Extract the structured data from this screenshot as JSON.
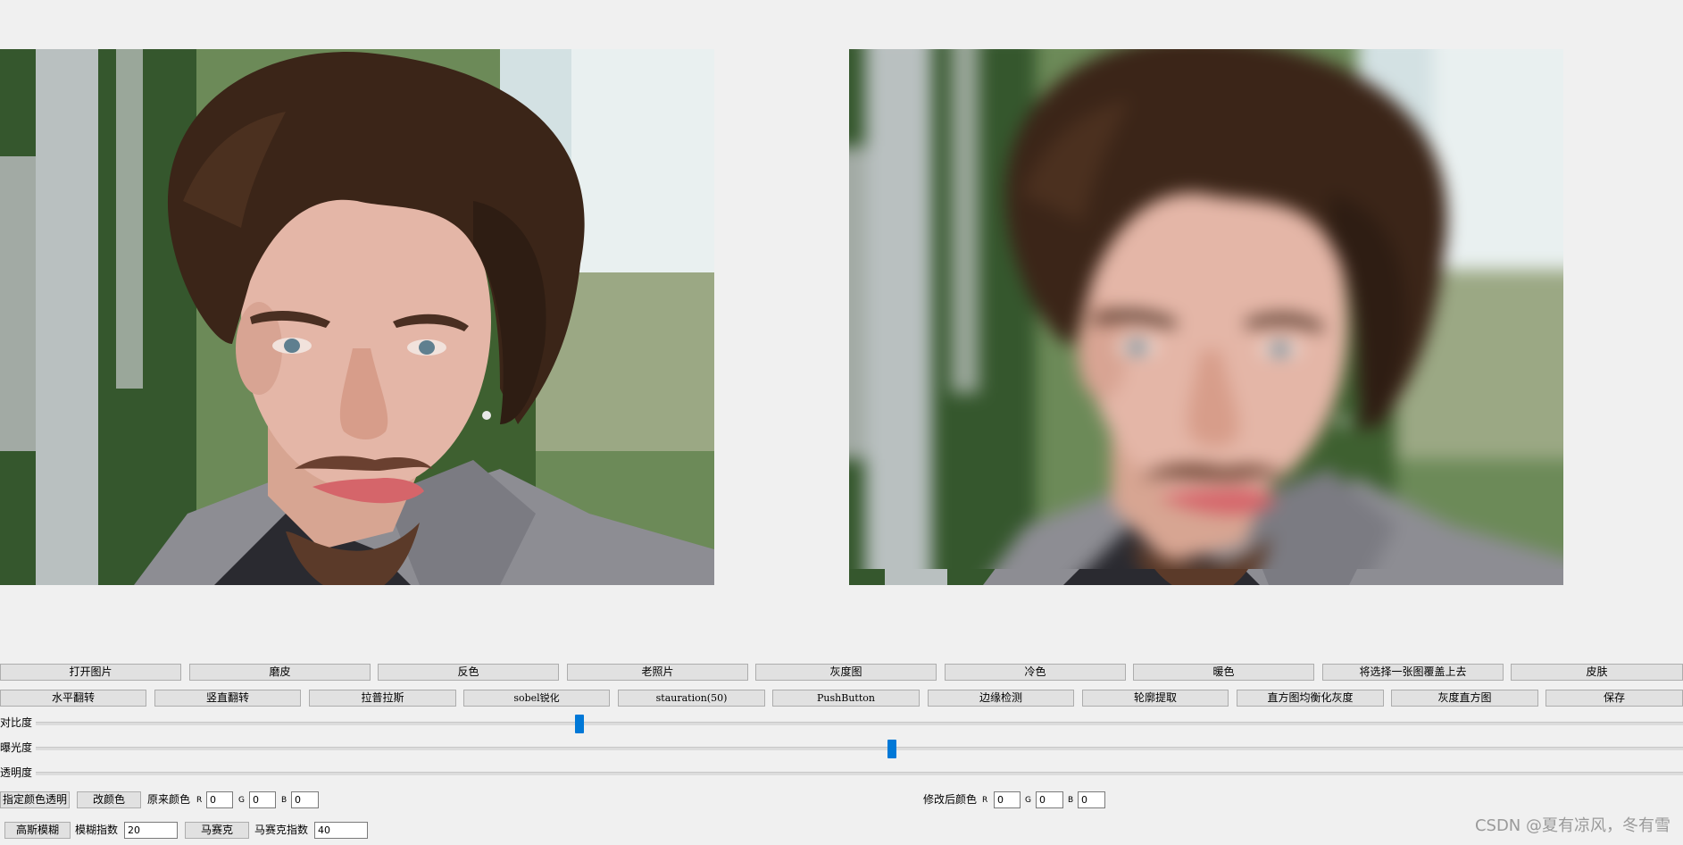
{
  "images": {
    "original": {
      "name": "original-portrait"
    },
    "processed": {
      "name": "blurred-portrait"
    }
  },
  "toolbar_row1": [
    {
      "label": "打开图片"
    },
    {
      "label": "磨皮"
    },
    {
      "label": "反色"
    },
    {
      "label": "老照片"
    },
    {
      "label": "灰度图"
    },
    {
      "label": "冷色"
    },
    {
      "label": "暖色"
    },
    {
      "label": "将选择一张图覆盖上去"
    },
    {
      "label": "皮肤"
    }
  ],
  "toolbar_row2": [
    {
      "label": "水平翻转"
    },
    {
      "label": "竖直翻转"
    },
    {
      "label": "拉普拉斯"
    },
    {
      "label": "sobel锐化"
    },
    {
      "label": "stauration(50)"
    },
    {
      "label": "PushButton"
    },
    {
      "label": "边缘检测"
    },
    {
      "label": "轮廓提取"
    },
    {
      "label": "直方图均衡化灰度"
    },
    {
      "label": "灰度直方图"
    },
    {
      "label": "保存"
    }
  ],
  "sliders": {
    "contrast": {
      "label": "对比度",
      "level": 0.33
    },
    "exposure": {
      "label": "曝光度",
      "level": 0.52
    },
    "opacity": {
      "label": "透明度",
      "level": null
    }
  },
  "color_row": {
    "transparent_button": "指定颜色透明",
    "change_color_button": "改颜色",
    "original_color_label": "原来颜色",
    "modified_color_label": "修改后颜色",
    "r_label": "R",
    "g_label": "G",
    "b_label": "B",
    "original": {
      "r": "0",
      "g": "0",
      "b": "0"
    },
    "modified": {
      "r": "0",
      "g": "0",
      "b": "0"
    }
  },
  "blur_row": {
    "gaussian_button": "高斯模糊",
    "blur_index_label": "模糊指数",
    "blur_index_value": "20",
    "mosaic_button": "马赛克",
    "mosaic_index_label": "马赛克指数",
    "mosaic_index_value": "40"
  },
  "watermark": "CSDN @夏有凉风，冬有雪",
  "colors": {
    "accent": "#0078d7",
    "button_bg": "#e1e1e1",
    "window_bg": "#f0f0f0"
  }
}
